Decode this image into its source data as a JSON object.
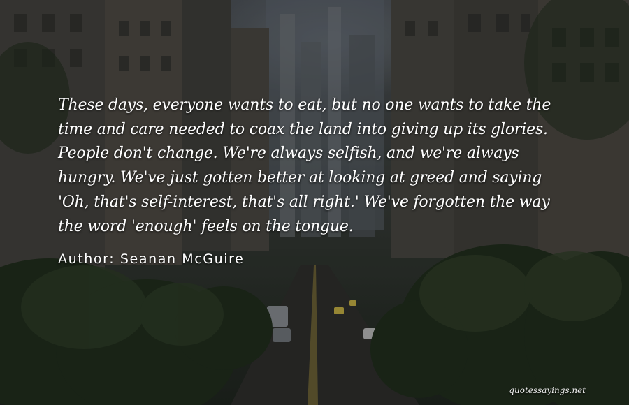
{
  "quote": {
    "lines": [
      "These days, everyone wants to eat, but no one wants to take the",
      "time and care needed to coax the land into giving up its glories.",
      "People don't change. We're always selfish, and we're always",
      "hungry. We've just gotten better at looking at greed and saying",
      "'Oh, that's self-interest, that's all right.' We've forgotten the way",
      "the word 'enough' feels on the tongue."
    ],
    "author_label": "Author: Seanan McGuire"
  },
  "watermark": "quotessayings.net",
  "colors": {
    "text": "#ffffff",
    "foliage_dark": "#1e2a1c",
    "building": "#3c4040"
  }
}
